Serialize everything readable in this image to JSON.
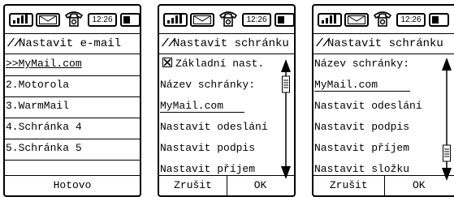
{
  "status": {
    "time": "12:26"
  },
  "screens": [
    {
      "title": "Nastavit e-mail",
      "items": [
        ">>MyMail.com",
        "2.Motorola",
        "3.WarmMail",
        "4.Schránka 4",
        "5.Schránka 5"
      ],
      "softkey": "Hotovo"
    },
    {
      "title": "Nastavit schránku",
      "checkbox_label": "Základní nast.",
      "items": [
        "Název schránky:",
        "MyMail.com",
        "Nastavit odeslání",
        "Nastavit podpis",
        "Nastavit příjem"
      ],
      "softkeys": [
        "Zrušit",
        "OK"
      ]
    },
    {
      "title": "Nastavit schránku",
      "items": [
        "Název schránky:",
        "MyMail.com",
        "Nastavit odeslání",
        "Nastavit podpis",
        "Nastavit příjem",
        "Nastavit složku"
      ],
      "softkeys": [
        "Zrušit",
        "OK"
      ]
    }
  ],
  "icons": [
    "signal-icon",
    "envelope-icon",
    "phone-icon",
    "battery-icon",
    "title-icon",
    "scroll-arrow-up-icon",
    "scroll-arrow-down-icon",
    "scroll-thumb-icon",
    "checkbox-icon"
  ]
}
